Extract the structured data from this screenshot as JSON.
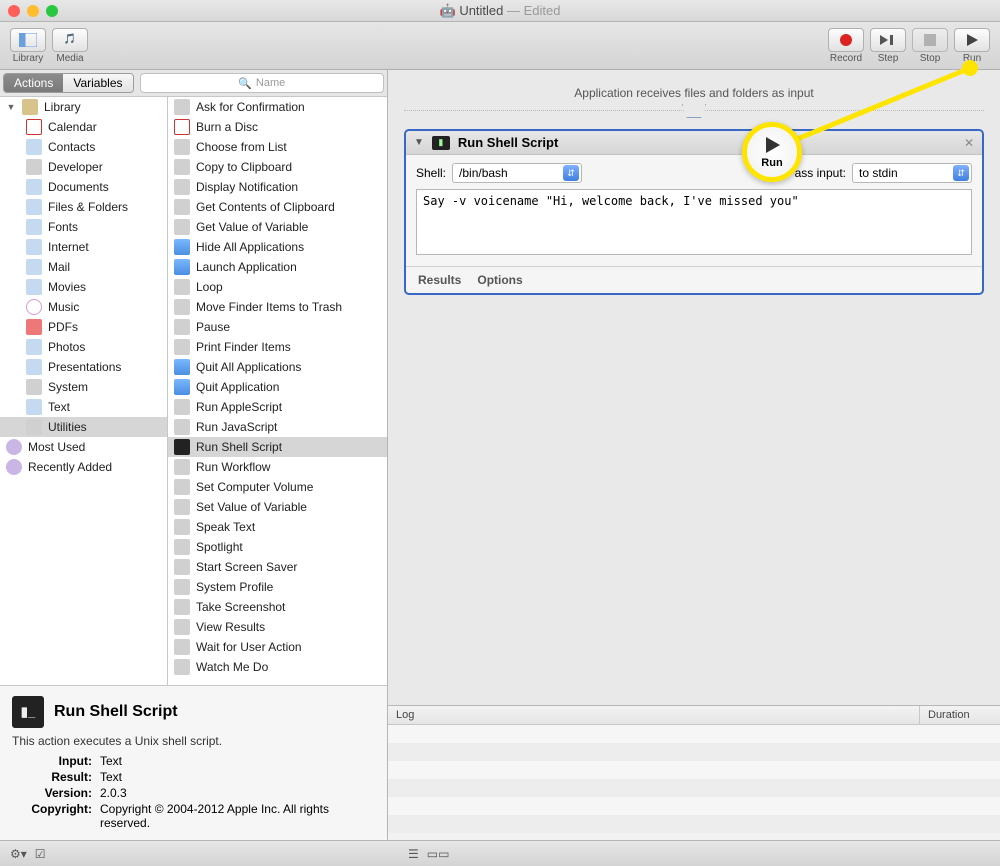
{
  "window": {
    "title": "Untitled",
    "edited": "— Edited"
  },
  "toolbar": {
    "library": "Library",
    "media": "Media",
    "record": "Record",
    "step": "Step",
    "stop": "Stop",
    "run": "Run"
  },
  "tabs": {
    "actions": "Actions",
    "variables": "Variables",
    "search_placeholder": "Name"
  },
  "library": {
    "root": "Library",
    "items": [
      "Calendar",
      "Contacts",
      "Developer",
      "Documents",
      "Files & Folders",
      "Fonts",
      "Internet",
      "Mail",
      "Movies",
      "Music",
      "PDFs",
      "Photos",
      "Presentations",
      "System",
      "Text",
      "Utilities"
    ],
    "extras": [
      "Most Used",
      "Recently Added"
    ]
  },
  "actions": [
    "Ask for Confirmation",
    "Burn a Disc",
    "Choose from List",
    "Copy to Clipboard",
    "Display Notification",
    "Get Contents of Clipboard",
    "Get Value of Variable",
    "Hide All Applications",
    "Launch Application",
    "Loop",
    "Move Finder Items to Trash",
    "Pause",
    "Print Finder Items",
    "Quit All Applications",
    "Quit Application",
    "Run AppleScript",
    "Run JavaScript",
    "Run Shell Script",
    "Run Workflow",
    "Set Computer Volume",
    "Set Value of Variable",
    "Speak Text",
    "Spotlight",
    "Start Screen Saver",
    "System Profile",
    "Take Screenshot",
    "View Results",
    "Wait for User Action",
    "Watch Me Do"
  ],
  "selected_action_index": 17,
  "description": {
    "title": "Run Shell Script",
    "blurb": "This action executes a Unix shell script.",
    "input_k": "Input:",
    "input_v": "Text",
    "result_k": "Result:",
    "result_v": "Text",
    "version_k": "Version:",
    "version_v": "2.0.3",
    "copyright_k": "Copyright:",
    "copyright_v": "Copyright © 2004-2012 Apple Inc.  All rights reserved."
  },
  "workflow": {
    "header": "Application receives files and folders as input",
    "card_title": "Run Shell Script",
    "shell_label": "Shell:",
    "shell_value": "/bin/bash",
    "pass_label": "Pass input:",
    "pass_value": "to stdin",
    "script": "Say -v voicename \"Hi, welcome back, I've missed you\"",
    "results": "Results",
    "options": "Options"
  },
  "log": {
    "col1": "Log",
    "col2": "Duration"
  },
  "callout": {
    "label": "Run"
  }
}
